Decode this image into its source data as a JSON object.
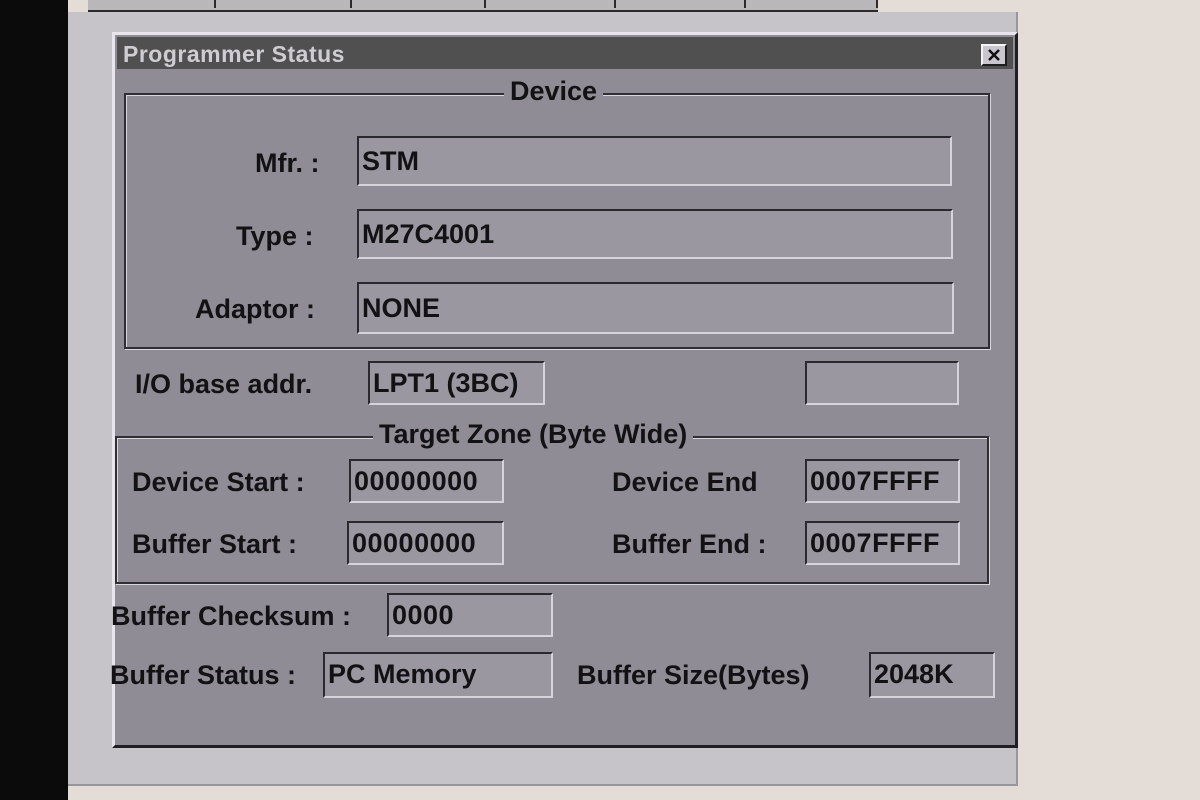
{
  "dialog": {
    "title": "Programmer Status"
  },
  "device": {
    "legend": "Device",
    "mfr_label": "Mfr. :",
    "mfr_value": "STM",
    "type_label": "Type :",
    "type_value": "M27C4001",
    "adaptor_label": "Adaptor :",
    "adaptor_value": "NONE"
  },
  "io": {
    "label": "I/O base addr.",
    "value": "LPT1 (3BC)",
    "extra_value": ""
  },
  "target_zone": {
    "legend": "Target Zone (Byte Wide)",
    "device_start_label": "Device Start :",
    "device_start_value": "00000000",
    "device_end_label": "Device End",
    "device_end_value": "0007FFFF",
    "buffer_start_label": "Buffer Start :",
    "buffer_start_value": "00000000",
    "buffer_end_label": "Buffer End :",
    "buffer_end_value": "0007FFFF"
  },
  "buffer": {
    "checksum_label": "Buffer Checksum :",
    "checksum_value": "0000",
    "status_label": "Buffer Status :",
    "status_value": "PC Memory",
    "size_label": "Buffer Size(Bytes)",
    "size_value": "2048K"
  },
  "icons": {
    "close": "close-icon"
  },
  "colors": {
    "titlebar": "#505050",
    "dialog_bg": "#8f8c95",
    "field_bg": "#9a97a0"
  }
}
